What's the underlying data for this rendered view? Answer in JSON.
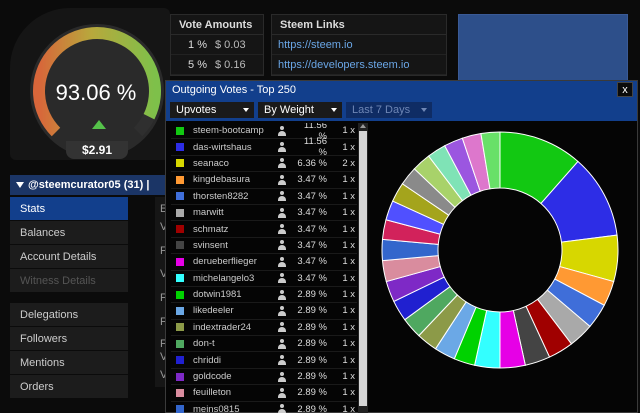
{
  "gauge": {
    "value": "93.06 %",
    "usd": "$2.91",
    "colors": [
      "#e04040",
      "#e07a3c",
      "#b6b63a",
      "#55c24a"
    ]
  },
  "vote_amounts": {
    "title": "Vote Amounts",
    "rows": [
      {
        "pct": "1 %",
        "amount": "$ 0.03"
      },
      {
        "pct": "5 %",
        "amount": "$ 0.16"
      }
    ]
  },
  "steem_links": {
    "title": "Steem Links",
    "items": [
      "https://steem.io",
      "https://developers.steem.io"
    ]
  },
  "account_bar": {
    "label": "@steemcurator05 (31)  |  Feed  |"
  },
  "menu": {
    "items": [
      "Stats",
      "Balances",
      "Account Details",
      "Witness Details",
      "Delegations",
      "Followers",
      "Mentions",
      "Orders"
    ]
  },
  "background_letters": [
    "E",
    "V",
    "F",
    "V",
    "F",
    "F",
    "F",
    "V",
    "V"
  ],
  "dialog": {
    "title": "Outgoing Votes - Top 250",
    "close": "x",
    "filters": {
      "type": "Upvotes",
      "sort": "By Weight",
      "period": "Last 7 Days"
    }
  },
  "votes": [
    {
      "name": "steem-bootcamp",
      "pct": "11.56 %",
      "count": "1 x",
      "color": "#12c812",
      "weight": 11.56
    },
    {
      "name": "das-wirtshaus",
      "pct": "11.56 %",
      "count": "1 x",
      "color": "#2d2de6",
      "weight": 11.56
    },
    {
      "name": "seanaco",
      "pct": "6.36 %",
      "count": "2 x",
      "color": "#d7d700",
      "weight": 6.36
    },
    {
      "name": "kingdebasura",
      "pct": "3.47 %",
      "count": "1 x",
      "color": "#ff9933",
      "weight": 3.47
    },
    {
      "name": "thorsten8282",
      "pct": "3.47 %",
      "count": "1 x",
      "color": "#3f6ed9",
      "weight": 3.47
    },
    {
      "name": "marwitt",
      "pct": "3.47 %",
      "count": "1 x",
      "color": "#a9a9a9",
      "weight": 3.47
    },
    {
      "name": "schmatz",
      "pct": "3.47 %",
      "count": "1 x",
      "color": "#a00000",
      "weight": 3.47
    },
    {
      "name": "svinsent",
      "pct": "3.47 %",
      "count": "1 x",
      "color": "#444444",
      "weight": 3.47
    },
    {
      "name": "derueberflieger",
      "pct": "3.47 %",
      "count": "1 x",
      "color": "#e600e6",
      "weight": 3.47
    },
    {
      "name": "michelangelo3",
      "pct": "3.47 %",
      "count": "1 x",
      "color": "#33ffff",
      "weight": 3.47
    },
    {
      "name": "dotwin1981",
      "pct": "2.89 %",
      "count": "1 x",
      "color": "#00d200",
      "weight": 2.89
    },
    {
      "name": "likedeeler",
      "pct": "2.89 %",
      "count": "1 x",
      "color": "#6ba8e6",
      "weight": 2.89
    },
    {
      "name": "indextrader24",
      "pct": "2.89 %",
      "count": "1 x",
      "color": "#8c9a48",
      "weight": 2.89
    },
    {
      "name": "don-t",
      "pct": "2.89 %",
      "count": "1 x",
      "color": "#4fa860",
      "weight": 2.89
    },
    {
      "name": "chriddi",
      "pct": "2.89 %",
      "count": "1 x",
      "color": "#2020d0",
      "weight": 2.89
    },
    {
      "name": "goldcode",
      "pct": "2.89 %",
      "count": "1 x",
      "color": "#7e29c6",
      "weight": 2.89
    },
    {
      "name": "feuilleton",
      "pct": "2.89 %",
      "count": "1 x",
      "color": "#d98c9e",
      "weight": 2.89
    },
    {
      "name": "meins0815",
      "pct": "2.89 %",
      "count": "1 x",
      "color": "#3366cc",
      "weight": 2.89
    }
  ],
  "donut_extra": [
    {
      "color": "#d2225b",
      "weight": 2.7
    },
    {
      "color": "#5050ff",
      "weight": 2.7
    },
    {
      "color": "#a4a41c",
      "weight": 2.7
    },
    {
      "color": "#8a8a8a",
      "weight": 2.6
    },
    {
      "color": "#a8d26a",
      "weight": 2.6
    },
    {
      "color": "#7fe3b6",
      "weight": 2.6
    },
    {
      "color": "#9b56e0",
      "weight": 2.6
    },
    {
      "color": "#dd77cc",
      "weight": 2.6
    },
    {
      "color": "#68e068",
      "weight": 2.6
    }
  ]
}
